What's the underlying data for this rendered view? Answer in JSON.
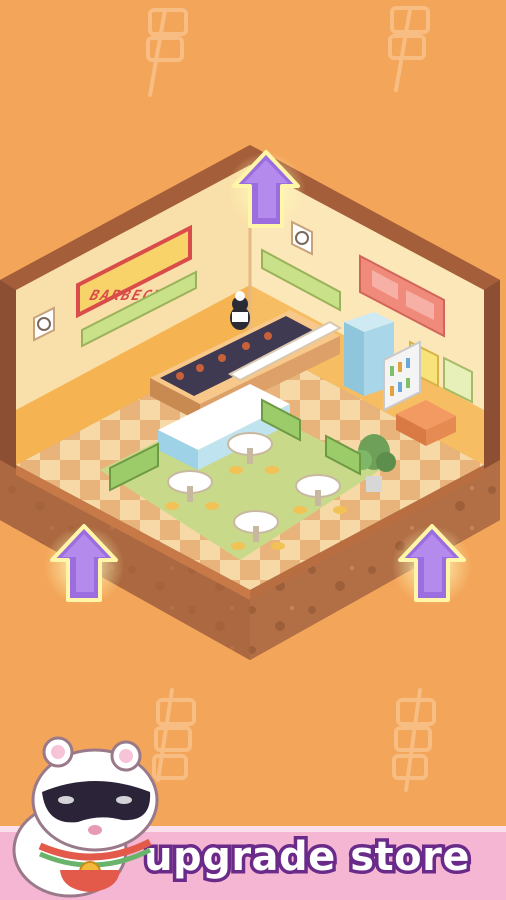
{
  "store": {
    "sign_text": "BARBECUE",
    "upgrade_arrows": 3
  },
  "banner": {
    "label": "upgrade store"
  },
  "colors": {
    "background": "#f3a55a",
    "banner": "#f5b6d3",
    "banner_text_outline": "#6a2a8a",
    "arrow": "#9b6ddf",
    "arrow_glow": "#fff6a8"
  },
  "icons": {
    "arrow": "up-arrow-icon",
    "skewer": "skewer-icon",
    "mascot": "masked-hamster-mascot"
  }
}
